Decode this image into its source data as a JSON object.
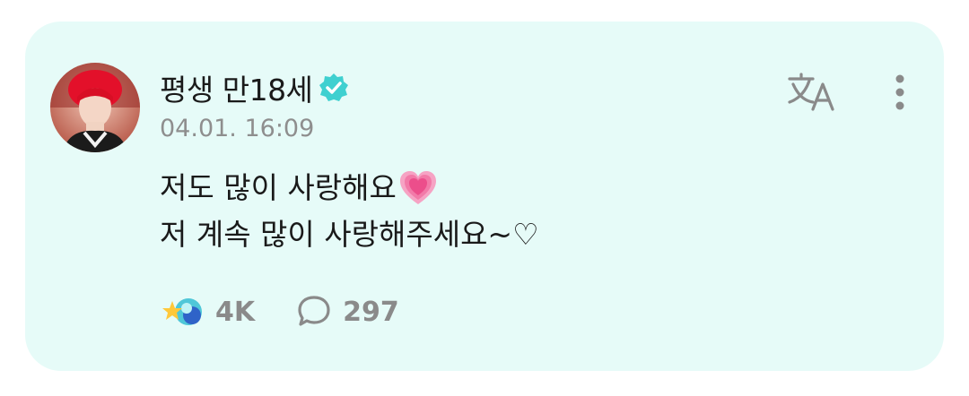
{
  "post": {
    "author_name": "평생 만18세",
    "verified": true,
    "timestamp": "04.01. 16:09",
    "content": {
      "line1": "저도 많이 사랑해요",
      "line1_emoji": "growing-heart-emoji",
      "line2": "저 계속 많이 사랑해주세요~♡"
    },
    "stats": {
      "reactions": "4K",
      "comments": "297"
    }
  },
  "colors": {
    "card_background": "#e6fbf8",
    "verified_badge": "#3fd0d0",
    "secondary_text": "#8e8e8e",
    "heart_pink": "#f0508c"
  },
  "icons": {
    "translate": "translate-icon",
    "more": "more-vertical-icon",
    "reaction": "reaction-star-icon",
    "comment": "comment-bubble-icon",
    "verified": "verified-badge-icon"
  }
}
